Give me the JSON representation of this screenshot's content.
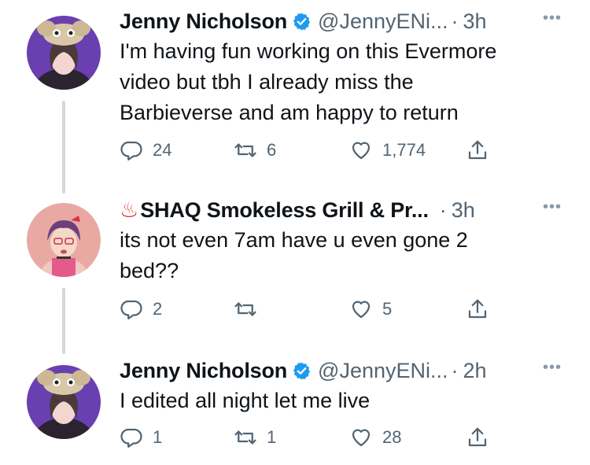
{
  "tweets": [
    {
      "name": "Jenny Nicholson",
      "handle": "@JennyENi...",
      "time": "3h",
      "text": "I'm having fun working on this Evermore\nvideo but tbh I already miss the\nBarbieverse and am happy to return",
      "replies": "24",
      "retweets": "6",
      "likes": "1,774",
      "verified": true
    },
    {
      "name_prefix": "♨",
      "name": "SHAQ Smokeless Grill & Pr...",
      "time": "3h",
      "text": "its not even 7am have u even gone 2\nbed??",
      "replies": "2",
      "retweets": "",
      "likes": "5",
      "verified": false
    },
    {
      "name": "Jenny Nicholson",
      "handle": "@JennyENi...",
      "time": "2h",
      "text": "I edited all night let me live",
      "replies": "1",
      "retweets": "1",
      "likes": "28",
      "verified": true
    }
  ],
  "ui": {
    "separator_dot": "·",
    "more_label": "•••",
    "accent_color": "#1d9bf0",
    "icon_color": "#536471"
  }
}
